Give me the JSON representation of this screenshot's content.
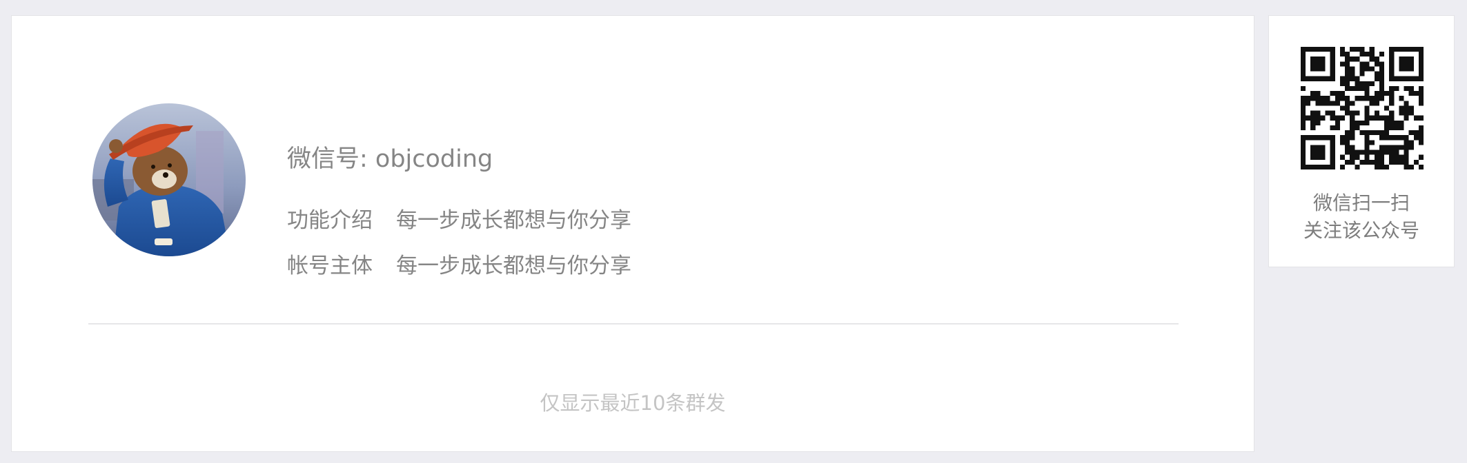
{
  "profile": {
    "wechat_id": "微信号: objcoding",
    "avatar_icon": "paddington-bear-avatar",
    "rows": [
      {
        "label": "功能介绍",
        "value": "每一步成长都想与你分享"
      },
      {
        "label": "帐号主体",
        "value": "每一步成长都想与你分享"
      }
    ]
  },
  "footer": {
    "note": "仅显示最近10条群发"
  },
  "qr": {
    "icon": "qr-code-icon",
    "line1": "微信扫一扫",
    "line2": "关注该公众号"
  },
  "colors": {
    "page_bg": "#ededf2",
    "card_bg": "#ffffff",
    "text_primary": "#858585",
    "text_muted": "#c4c4c4"
  }
}
